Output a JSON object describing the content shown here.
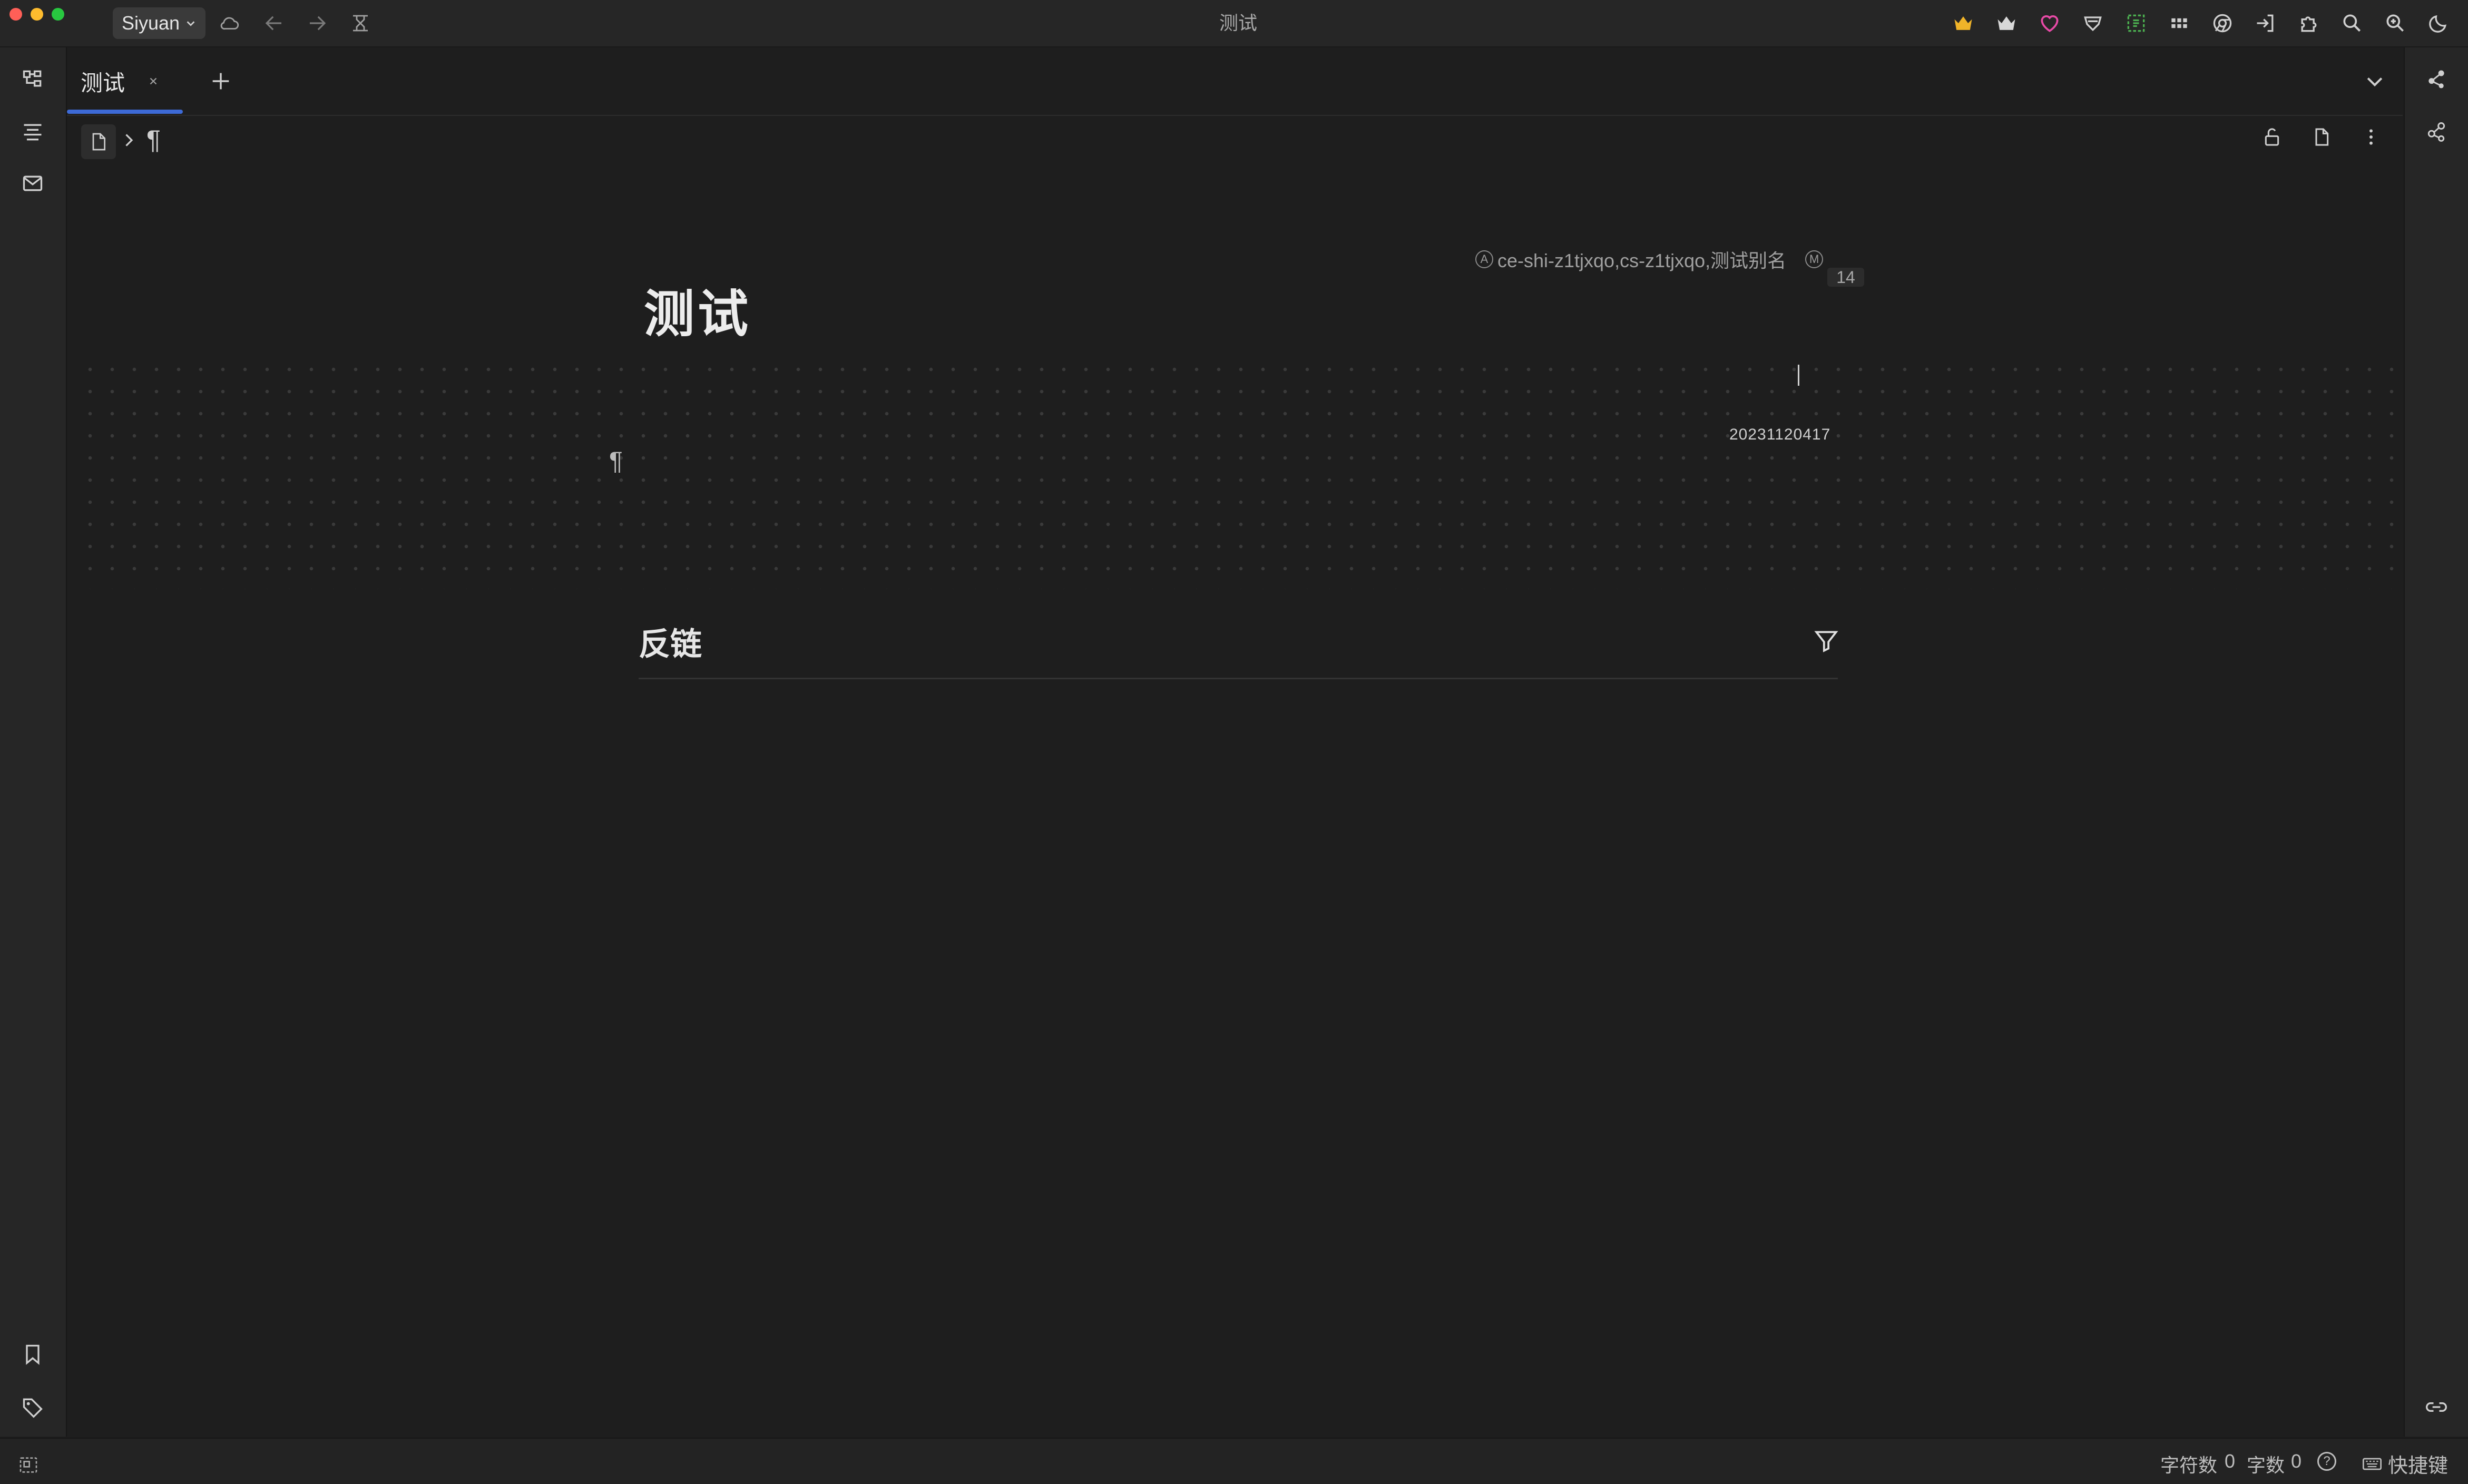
{
  "window": {
    "title": "测试",
    "traffic_lights": [
      "#ff5f57",
      "#febc2e",
      "#28c840"
    ]
  },
  "toolbar": {
    "workspace_label": "Siyuan",
    "left_icons": [
      "cloud-sync-icon",
      "back-arrow-icon",
      "forward-arrow-icon",
      "readonly-toggle-icon"
    ],
    "right_icons": [
      "crown-gold-icon",
      "crown-white-icon",
      "heart-icon",
      "shield-icon",
      "bracket-plugin-icon",
      "grid-plugin-icon",
      "chrome-icon",
      "sign-in-icon",
      "puzzle-icon",
      "search-icon",
      "zoom-icon",
      "moon-icon"
    ]
  },
  "tabs": [
    {
      "label": "测试",
      "active": true
    }
  ],
  "breadcrumb": {
    "items": [
      "file-icon",
      "chevron-right-icon",
      "paragraph-icon"
    ]
  },
  "document": {
    "title": "测试",
    "alias": "ce-shi-z1tjxqo,cs-z1tjxqo,测试别名",
    "alias_marker": "A",
    "memo_marker": "M",
    "attr_count": "14",
    "date_text": "20231120417",
    "paragraph_mark": "¶",
    "backlinks_title": "反链"
  },
  "status": {
    "char_count_label": "字符数",
    "char_count": "0",
    "word_count_label": "字数",
    "word_count": "0",
    "help_symbol": "?",
    "shortcut_label": "快捷键"
  },
  "colors": {
    "accent": "#3d6ad6",
    "heart": "#e84aa7",
    "crown": "#f0b429"
  }
}
